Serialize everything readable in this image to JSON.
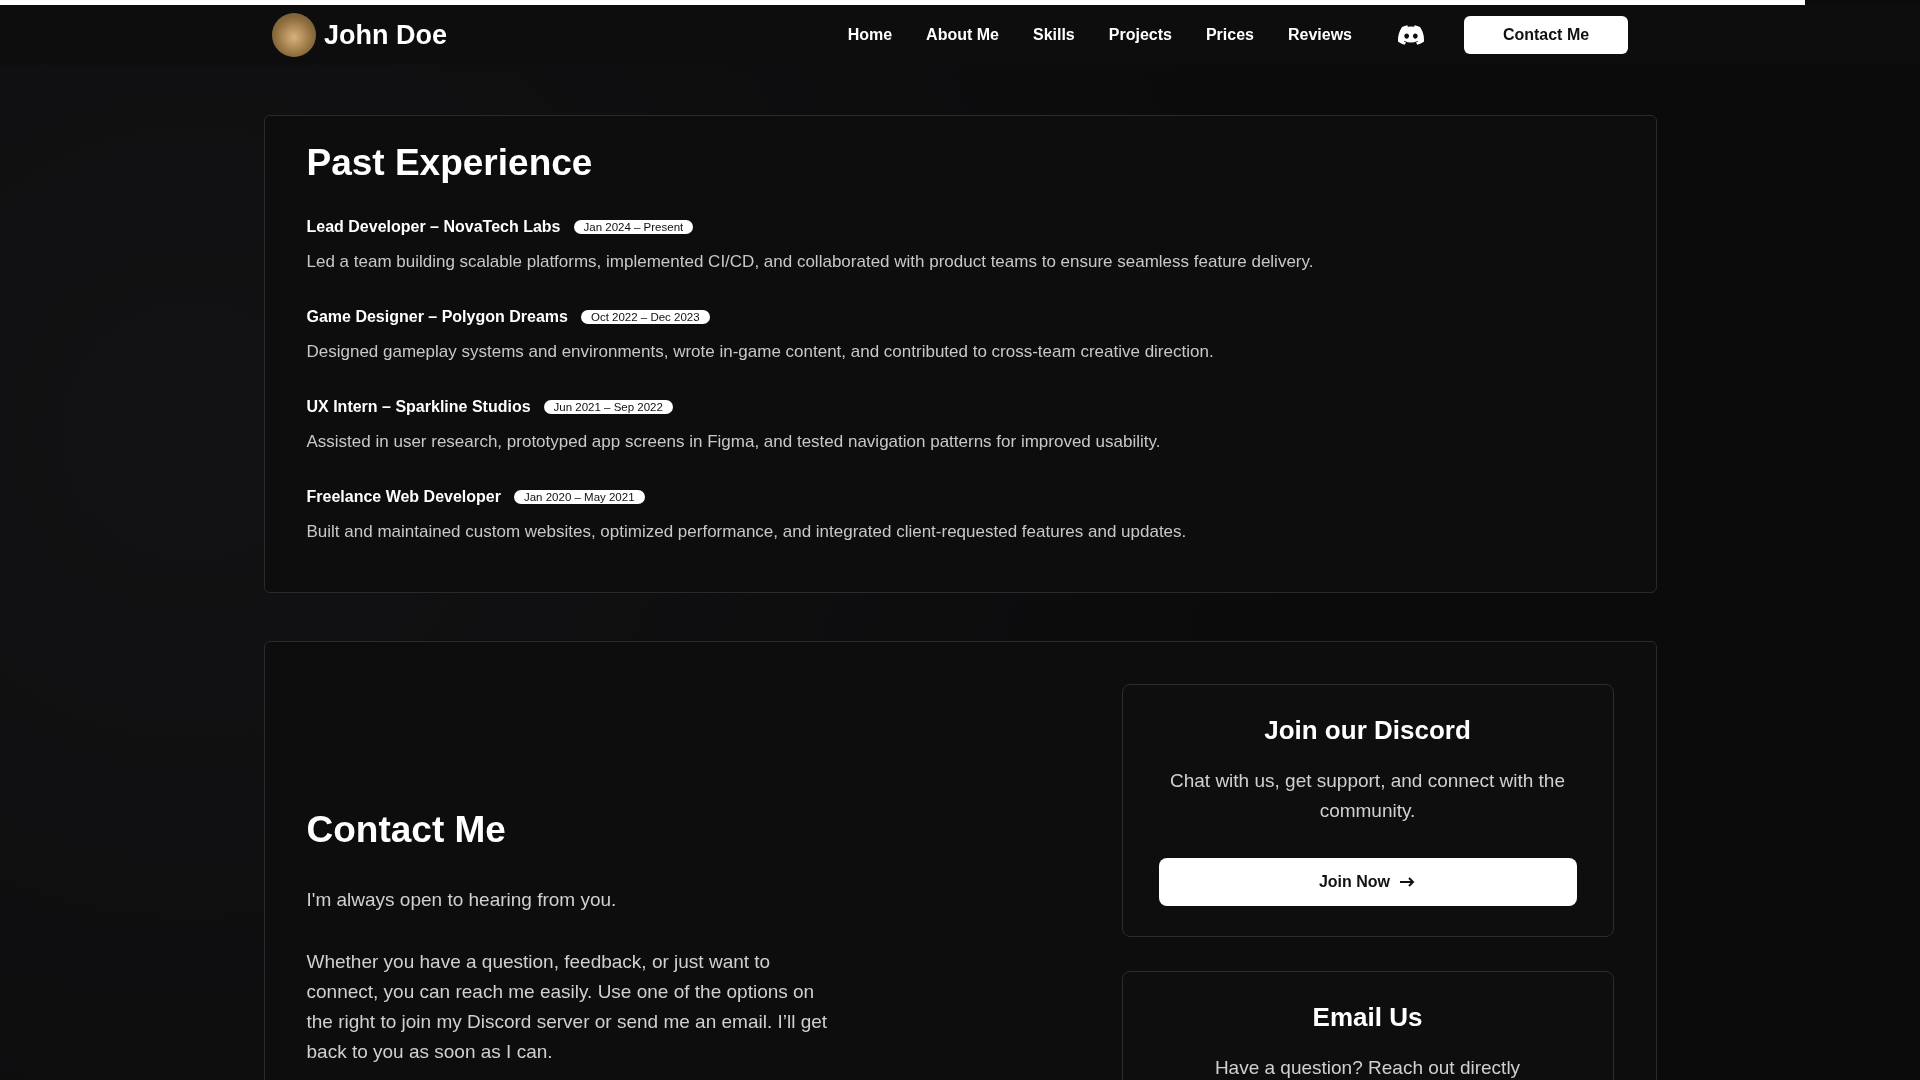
{
  "scroll_progress": {
    "level": 0.94
  },
  "header": {
    "name": "John Doe",
    "nav": [
      "Home",
      "About Me",
      "Skills",
      "Projects",
      "Prices",
      "Reviews"
    ],
    "contact_button": "Contact Me"
  },
  "experience": {
    "title": "Past Experience",
    "items": [
      {
        "role": "Lead Developer – NovaTech Labs",
        "dates": "Jan 2024 – Present",
        "description": "Led a team building scalable platforms, implemented CI/CD, and collaborated with product teams to ensure seamless feature delivery."
      },
      {
        "role": "Game Designer – Polygon Dreams",
        "dates": "Oct 2022 – Dec 2023",
        "description": "Designed gameplay systems and environments, wrote in-game content, and contributed to cross-team creative direction."
      },
      {
        "role": "UX Intern – Sparkline Studios",
        "dates": "Jun 2021 – Sep 2022",
        "description": "Assisted in user research, prototyped app screens in Figma, and tested navigation patterns for improved usability."
      },
      {
        "role": "Freelance Web Developer",
        "dates": "Jan 2020 – May 2021",
        "description": "Built and maintained custom websites, optimized performance, and integrated client-requested features and updates."
      }
    ]
  },
  "contact": {
    "title": "Contact Me",
    "intro": "I'm always open to hearing from you.",
    "body": "Whether you have a question, feedback, or just want to connect, you can reach me easily. Use one of the options on the right to join my Discord server or send me an email. I’ll get back to you as soon as I can.",
    "cards": [
      {
        "kind": "discord",
        "title": "Join our Discord",
        "text": "Chat with us, get support, and connect with the community.",
        "button": "Join Now"
      },
      {
        "kind": "email",
        "title": "Email Us",
        "text": "Have a question? Reach out directly"
      }
    ]
  }
}
